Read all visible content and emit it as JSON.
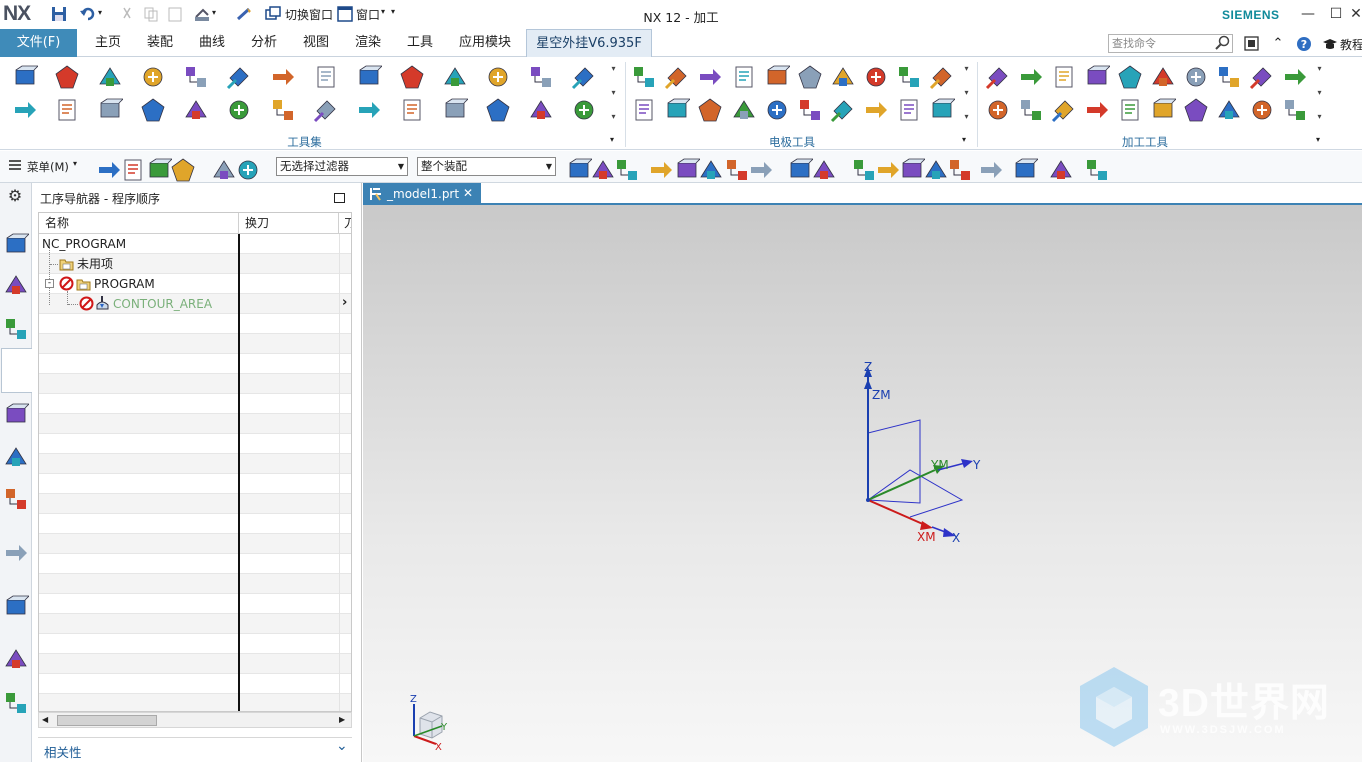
{
  "app": {
    "logo": "NX",
    "window_title": "NX 12 - 加工",
    "brand": "SIEMENS",
    "quick_access": {
      "switch_window": "切换窗口",
      "window_menu": "窗口"
    }
  },
  "ribbon": {
    "file_tab": "文件(F)",
    "tabs": [
      "主页",
      "装配",
      "曲线",
      "分析",
      "视图",
      "渲染",
      "工具",
      "应用模块",
      "星空外挂V6.935F"
    ],
    "active_tab": "星空外挂V6.935F",
    "search_placeholder": "查找命令",
    "tutorial_label": "教程",
    "groups": [
      {
        "label": "工具集"
      },
      {
        "label": "电极工具"
      },
      {
        "label": "加工工具"
      }
    ]
  },
  "toolbar": {
    "menu_label": "菜单(M)",
    "selection_filter": "无选择过滤器",
    "assembly_scope": "整个装配"
  },
  "navigator": {
    "title": "工序导航器 - 程序顺序",
    "columns": [
      "名称",
      "换刀",
      "刀"
    ],
    "rows": [
      {
        "name": "NC_PROGRAM"
      },
      {
        "name": "未用项"
      },
      {
        "name": "PROGRAM"
      },
      {
        "name": "CONTOUR_AREA"
      }
    ],
    "dependency_panel": "相关性"
  },
  "document": {
    "tab_name": "_model1.prt"
  },
  "csys": {
    "labels": {
      "z": "Z",
      "zm": "ZM",
      "y": "Y",
      "ym": "YM",
      "x": "X",
      "xm": "XM"
    },
    "mini_labels": {
      "z": "Z",
      "y": "Y",
      "x": "X"
    }
  },
  "watermark": {
    "text": "3D世界网",
    "url_text": "WWW.3DSJW.COM"
  },
  "colors": {
    "accent": "#3c82b4",
    "file_tab": "#3f8bb9",
    "group_label": "#2e6e9e",
    "inactive_op": "#7ab07a",
    "axis_z": "#1a3fb0",
    "axis_y": "#2a8a2a",
    "axis_x": "#cc1b1b"
  }
}
